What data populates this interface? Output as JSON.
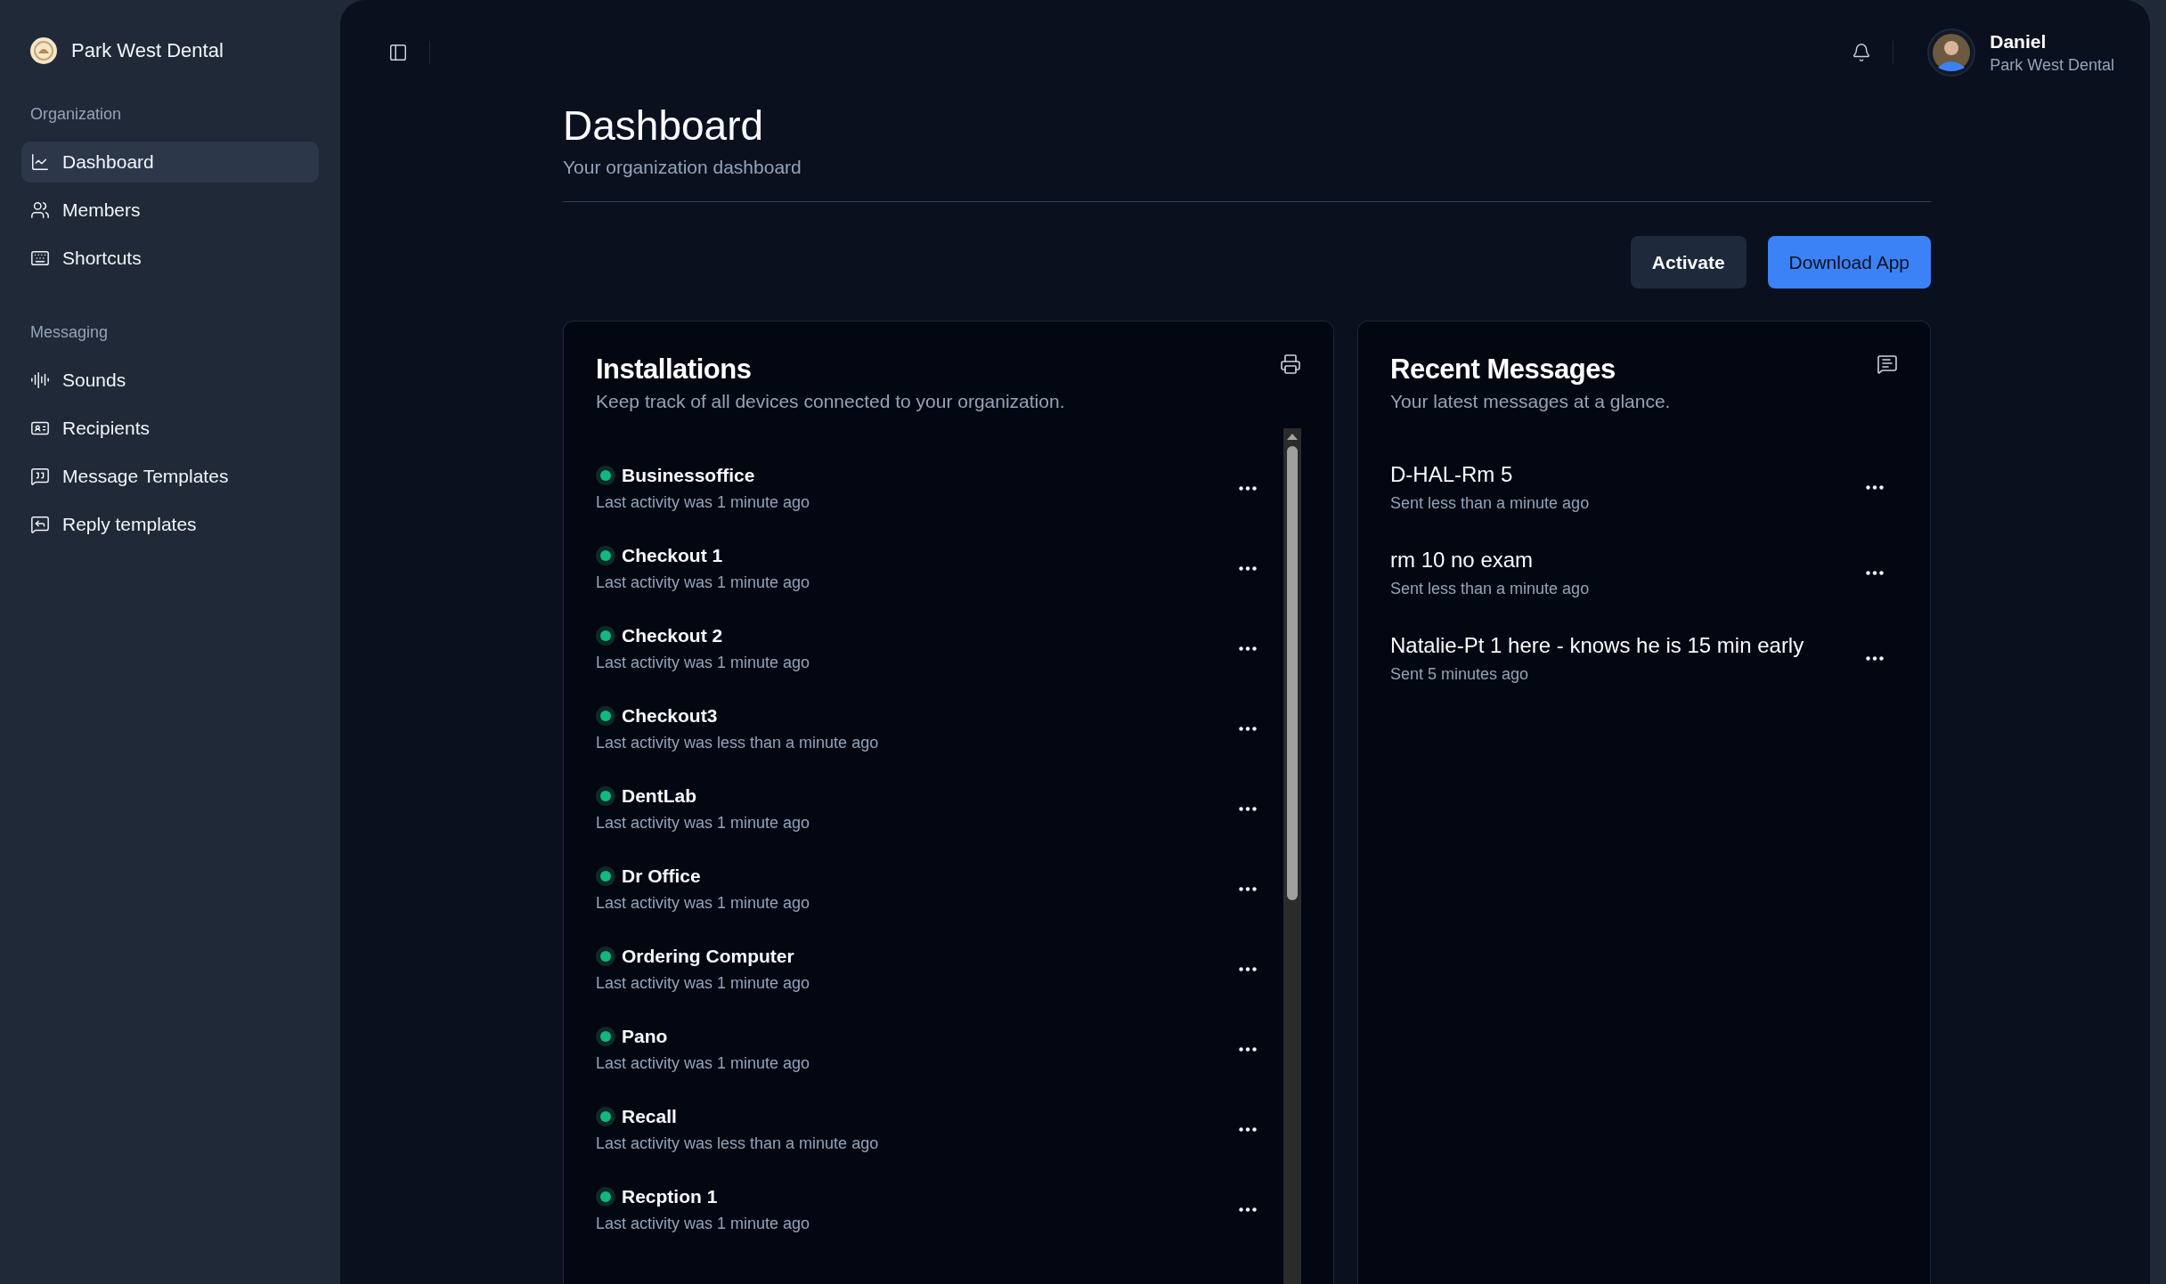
{
  "sidebar": {
    "org_name": "Park West Dental",
    "sections": [
      {
        "title": "Organization",
        "items": [
          {
            "label": "Dashboard",
            "selected": true
          },
          {
            "label": "Members",
            "selected": false
          },
          {
            "label": "Shortcuts",
            "selected": false
          }
        ]
      },
      {
        "title": "Messaging",
        "items": [
          {
            "label": "Sounds",
            "selected": false
          },
          {
            "label": "Recipients",
            "selected": false
          },
          {
            "label": "Message Templates",
            "selected": false
          },
          {
            "label": "Reply templates",
            "selected": false
          }
        ]
      }
    ]
  },
  "user": {
    "name": "Daniel",
    "org": "Park West Dental"
  },
  "page": {
    "title": "Dashboard",
    "subtitle": "Your organization dashboard"
  },
  "actions": [
    {
      "label": "Activate",
      "kind": "secondary"
    },
    {
      "label": "Download App",
      "kind": "primary"
    }
  ],
  "installations": {
    "title": "Installations",
    "subtitle": "Keep track of all devices connected to your organization.",
    "items": [
      {
        "name": "Businessoffice",
        "activity": "Last activity was 1 minute ago"
      },
      {
        "name": "Checkout 1",
        "activity": "Last activity was 1 minute ago"
      },
      {
        "name": "Checkout 2",
        "activity": "Last activity was 1 minute ago"
      },
      {
        "name": "Checkout3",
        "activity": "Last activity was less than a minute ago"
      },
      {
        "name": "DentLab",
        "activity": "Last activity was 1 minute ago"
      },
      {
        "name": "Dr Office",
        "activity": "Last activity was 1 minute ago"
      },
      {
        "name": "Ordering Computer",
        "activity": "Last activity was 1 minute ago"
      },
      {
        "name": "Pano",
        "activity": "Last activity was 1 minute ago"
      },
      {
        "name": "Recall",
        "activity": "Last activity was less than a minute ago"
      },
      {
        "name": "Recption 1",
        "activity": "Last activity was 1 minute ago"
      }
    ]
  },
  "messages": {
    "title": "Recent Messages",
    "subtitle": "Your latest messages at a glance.",
    "items": [
      {
        "text": "D-HAL-Rm 5",
        "sent": "Sent less than a minute ago"
      },
      {
        "text": "rm 10 no exam",
        "sent": "Sent less than a minute ago"
      },
      {
        "text": "Natalie-Pt 1 here - knows he is 15 min early",
        "sent": "Sent 5 minutes ago"
      }
    ]
  }
}
